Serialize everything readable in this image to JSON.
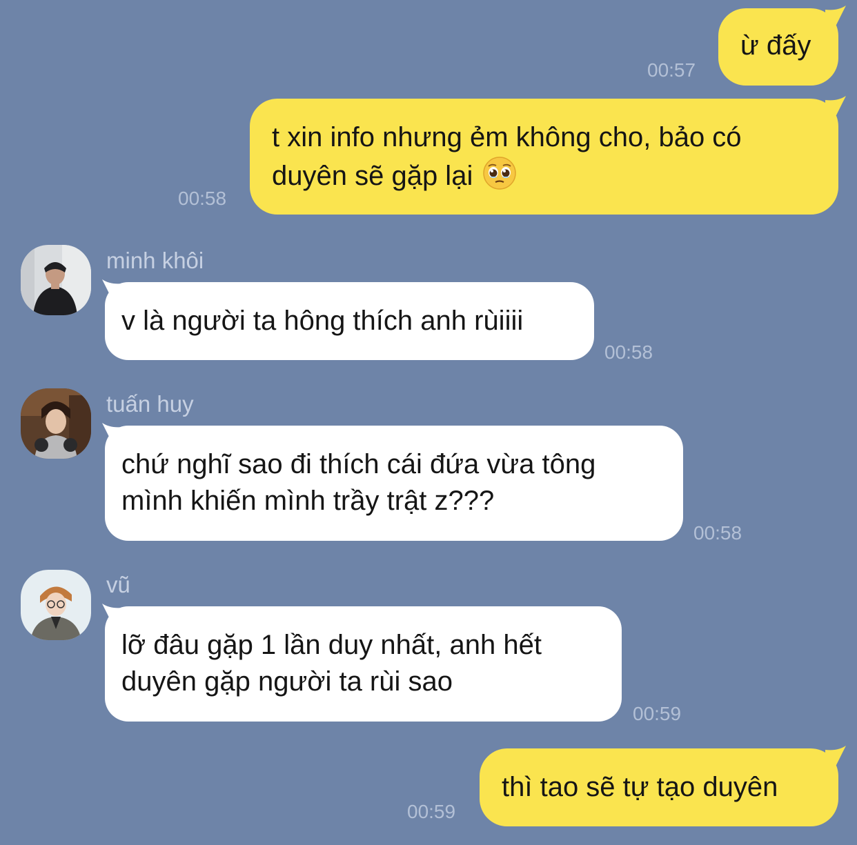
{
  "messages": [
    {
      "from": "me",
      "text": "ừ đấy",
      "time": "00:57"
    },
    {
      "from": "me",
      "line1": "t xin info nhưng ẻm không cho, bảo có",
      "line2": "duyên sẽ gặp lại",
      "emoji": "pleading-face-icon",
      "time": "00:58"
    },
    {
      "from": "minh khôi",
      "sender": "minh khôi",
      "text": "v là người ta hông thích anh rùiiii",
      "time": "00:58"
    },
    {
      "from": "tuấn huy",
      "sender": "tuấn huy",
      "line1": "chứ nghĩ sao đi thích cái đứa vừa tông",
      "line2": "mình khiến mình trầy trật z???",
      "time": "00:58"
    },
    {
      "from": "vũ",
      "sender": "vũ",
      "line1": "lỡ đâu gặp 1 lần duy nhất, anh hết",
      "line2": "duyên gặp người ta rùi sao",
      "time": "00:59"
    },
    {
      "from": "me",
      "text": "thì tao sẽ tự tạo duyên",
      "time": "00:59"
    }
  ],
  "colors": {
    "background": "#6e84a8",
    "outgoing_bubble": "#fae44f",
    "incoming_bubble": "#ffffff",
    "timestamp": "#b3c0d6",
    "sender_name": "#c6d0e2"
  }
}
